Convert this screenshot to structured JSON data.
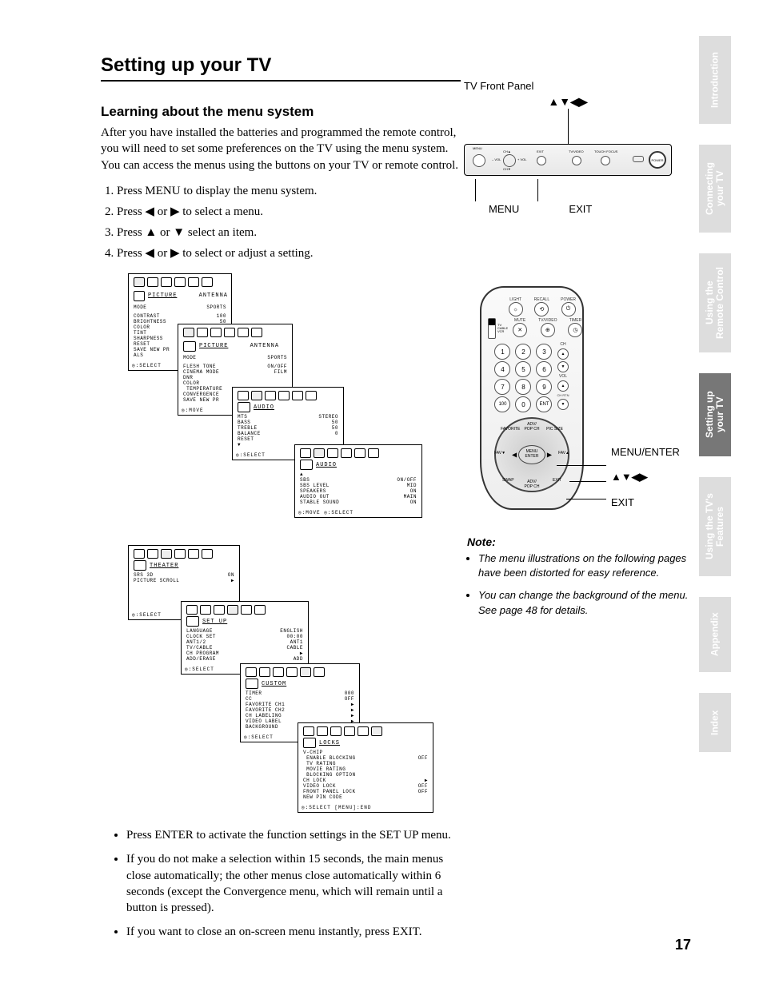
{
  "page": {
    "title": "Setting up your TV",
    "section_title": "Learning about the menu system",
    "intro": "After you have installed the batteries and programmed the remote control, you will need to set some preferences on the TV using the menu system. You can access the menus using the buttons on your TV or remote control.",
    "steps": [
      "Press MENU to display the menu system.",
      "Press ◀ or ▶ to select a menu.",
      "Press ▲ or ▼ select an item.",
      "Press ◀ or ▶ to select or adjust a setting."
    ],
    "lower_bullets": [
      "Press ENTER to activate the function settings in the SET UP menu.",
      "If you do not make a selection within 15 seconds, the main menus close automatically; the other menus close automatically within 6 seconds (except the Convergence menu, which will remain until a button is pressed).",
      "If you want to close an on-screen menu instantly, press EXIT."
    ],
    "number": "17"
  },
  "front_panel": {
    "title": "TV Front Panel",
    "arrow_cluster": "▲▼◀▶",
    "labels": {
      "menu": "MENU",
      "exit": "EXIT",
      "vol_minus": "– VOL",
      "vol_plus": "+ VOL",
      "ch_up": "CH▲",
      "ch_down": "CH▼",
      "tv_video": "TV/VIDEO",
      "touch_focus": "TOUCH FOCUS",
      "power": "POWER"
    }
  },
  "remote": {
    "top_labels": {
      "light": "LIGHT",
      "recall": "RECALL",
      "power": "POWER",
      "mute": "MUTE",
      "tvvideo": "TV/VIDEO",
      "timer": "TIMER"
    },
    "switch_labels": [
      "TV",
      "CABLE",
      "VCR"
    ],
    "digits": [
      "1",
      "2",
      "3",
      "4",
      "5",
      "6",
      "7",
      "8",
      "9",
      "100",
      "0",
      "ENT"
    ],
    "vol_ch": {
      "ch": "CH",
      "vol": "VOL",
      "chrtn": "CH RTN"
    },
    "wheel": {
      "center_l1": "MENU",
      "center_l2": "ENTER",
      "fav_up": "FAVORITE",
      "fav_dn": "EXIT",
      "fav_l": "FAV▼",
      "fav_r": "FAV▲",
      "pop_up": "ADV/\nPOP CH",
      "pop_dn": "ADV/\nPOP CH",
      "picsize": "PIC SIZE",
      "swap": "SWAP"
    },
    "callouts": {
      "menu": "MENU/ENTER",
      "arrows": "▲▼◀▶",
      "exit": "EXIT"
    }
  },
  "notes": {
    "heading": "Note:",
    "items": [
      "The menu illustrations on the following pages have been distorted for easy reference.",
      "You can change the background of the menu. See page 48 for details."
    ]
  },
  "tabs": [
    {
      "label": "Introduction",
      "active": false
    },
    {
      "label": "Connecting your TV",
      "active": false
    },
    {
      "label": "Using the Remote Control",
      "active": false
    },
    {
      "label": "Setting up your TV",
      "active": true
    },
    {
      "label": "Using the TV's Features",
      "active": false
    },
    {
      "label": "Appendix",
      "active": false
    },
    {
      "label": "Index",
      "active": false
    }
  ],
  "osd": {
    "picture1": {
      "title": "PICTURE",
      "tab2": "ANTENNA",
      "rows": [
        [
          "MODE",
          "SPORTS"
        ],
        [
          "CONTRAST",
          "100"
        ],
        [
          "BRIGHTNESS",
          "50"
        ],
        [
          "COLOR",
          ""
        ],
        [
          "TINT",
          ""
        ],
        [
          "SHARPNESS",
          ""
        ],
        [
          "RESET",
          ""
        ],
        [
          "SAVE NEW PR",
          ""
        ],
        [
          "ALS",
          ""
        ]
      ],
      "foot": "◎:SELECT"
    },
    "picture2": {
      "title": "PICTURE",
      "tab2": "ANTENNA",
      "rows": [
        [
          "MODE",
          "SPORTS"
        ],
        [
          "FLESH TONE",
          "ON/OFF"
        ],
        [
          "CINEMA MODE",
          "FILM"
        ],
        [
          "DNR",
          ""
        ],
        [
          "COLOR",
          ""
        ],
        [
          " TEMPERATURE",
          ""
        ],
        [
          "CONVERGENCE",
          ""
        ],
        [
          "SAVE NEW PR",
          ""
        ]
      ],
      "foot": "◎:MOVE"
    },
    "audio1": {
      "title": "AUDIO",
      "rows": [
        [
          "MTS",
          "STEREO"
        ],
        [
          "BASS",
          "50"
        ],
        [
          "TREBLE",
          "50"
        ],
        [
          "BALANCE",
          "0"
        ],
        [
          "RESET",
          ""
        ],
        [
          "▼",
          ""
        ]
      ],
      "foot": "◎:SELECT"
    },
    "audio2": {
      "title": "AUDIO",
      "rows": [
        [
          "▲",
          ""
        ],
        [
          "SBS",
          "ON/OFF"
        ],
        [
          "SBS LEVEL",
          "MID"
        ],
        [
          "SPEAKERS",
          "ON"
        ],
        [
          "AUDIO OUT",
          "MAIN"
        ],
        [
          "STABLE SOUND",
          "ON"
        ]
      ],
      "foot": "◎:MOVE      ◎:SELECT"
    },
    "theater": {
      "title": "THEATER",
      "rows": [
        [
          "SRS 3D",
          "ON"
        ],
        [
          "PICTURE SCROLL",
          "▶"
        ]
      ],
      "foot": "◎:SELECT"
    },
    "setup": {
      "title": "SET UP",
      "rows": [
        [
          "LANGUAGE",
          "ENGLISH"
        ],
        [
          "CLOCK SET",
          "00:00"
        ],
        [
          "ANT1/2",
          "ANT1"
        ],
        [
          "TV/CABLE",
          "CABLE"
        ],
        [
          "CH PROGRAM",
          "▶"
        ],
        [
          "ADD/ERASE",
          "ADD"
        ]
      ],
      "foot": "◎:SELECT"
    },
    "custom": {
      "title": "CUSTOM",
      "rows": [
        [
          "TIMER",
          "000"
        ],
        [
          "CC",
          "OFF"
        ],
        [
          "FAVORITE CH1",
          "▶"
        ],
        [
          "FAVORITE CH2",
          "▶"
        ],
        [
          "CH LABELING",
          "▶"
        ],
        [
          "VIDEO LABEL",
          "▶"
        ],
        [
          "BACKGROUND",
          ""
        ]
      ],
      "foot": "◎:SELECT"
    },
    "locks": {
      "title": "LOCKS",
      "rows": [
        [
          "V-CHIP",
          ""
        ],
        [
          " ENABLE BLOCKING",
          "OFF"
        ],
        [
          " TV RATING",
          ""
        ],
        [
          " MOVIE RATING",
          ""
        ],
        [
          " BLOCKING OPTION",
          ""
        ],
        [
          "CH LOCK",
          "▶"
        ],
        [
          "VIDEO LOCK",
          "OFF"
        ],
        [
          "FRONT PANEL LOCK",
          "OFF"
        ],
        [
          "NEW PIN CODE",
          ""
        ]
      ],
      "foot": "◎:SELECT   [MENU]:END"
    }
  }
}
